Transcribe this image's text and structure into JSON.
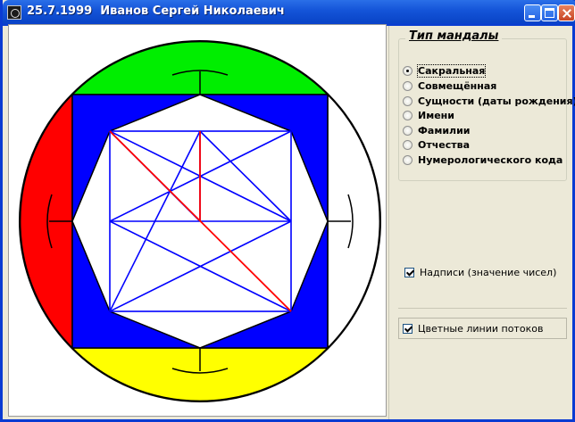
{
  "window": {
    "title": "25.7.1999  Иванов Сергей Николаевич",
    "icon": "app-mandala-icon"
  },
  "mandala_type": {
    "legend": "Тип мандалы",
    "options": [
      {
        "label": "Сакральная",
        "checked": true
      },
      {
        "label": "Совмещённая",
        "checked": false
      },
      {
        "label": "Сущности (даты рождения)",
        "checked": false
      },
      {
        "label": "Имени",
        "checked": false
      },
      {
        "label": "Фамилии",
        "checked": false
      },
      {
        "label": "Отчества",
        "checked": false
      },
      {
        "label": "Нумерологического кода",
        "checked": false
      }
    ]
  },
  "options": {
    "labels_checkbox": {
      "label": "Надписи (значение чисел)",
      "checked": true
    },
    "colored_lines_checkbox": {
      "label": "Цветные линии потоков",
      "checked": true
    }
  },
  "mandala_colors": {
    "top_segment": "#00ee00",
    "left_segment": "#ff0000",
    "bottom_segment": "#ffff00",
    "right_segment": "#ffffff",
    "square": "#0000ff",
    "octagon_fill": "#ffffff",
    "inner_lines": "#0000ff",
    "flow_lines": "#ff0000",
    "outline": "#000000"
  }
}
